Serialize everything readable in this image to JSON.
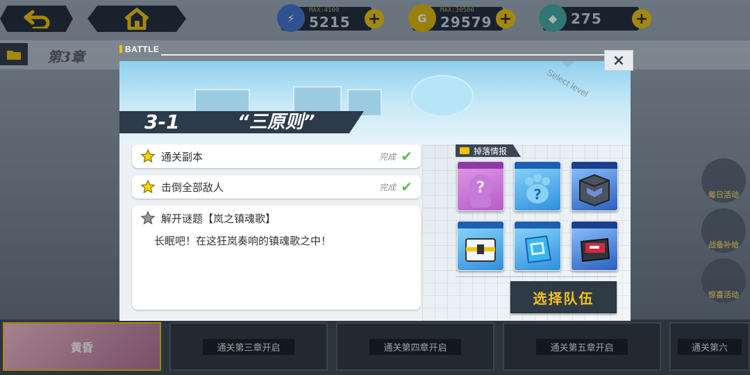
{
  "topbar": {
    "resources": [
      {
        "name": "stamina",
        "max_label": "MAX:4100",
        "value": "5215",
        "color": "#3d6fc9"
      },
      {
        "name": "coins",
        "max_label": "MAX:30500",
        "value": "29579",
        "color": "#e2b400"
      },
      {
        "name": "crystals",
        "value": "275",
        "color": "#41a6a0"
      }
    ]
  },
  "chapter": {
    "title": "第3章"
  },
  "side_buttons": [
    {
      "label": "每日活动"
    },
    {
      "label": "战备补给"
    },
    {
      "label": "惊喜活动"
    }
  ],
  "chapters": [
    {
      "text": "黄昏",
      "state": "active"
    },
    {
      "text": "通关第三章开启"
    },
    {
      "text": "通关第四章开启"
    },
    {
      "text": "通关第五章开启"
    },
    {
      "text": "通关第六"
    }
  ],
  "modal": {
    "battle_label": "BATTLE",
    "select_level": "Select level",
    "stage_number": "3-1",
    "stage_name": "“三原则”",
    "close_icon": "×",
    "objectives": [
      {
        "text": "通关副本",
        "status": "完成",
        "completed": true
      },
      {
        "text": "击倒全部敌人",
        "status": "完成",
        "completed": true
      }
    ],
    "story_objective": {
      "text": "解开谜题【岚之镇魂歌】",
      "body": "长眠吧！在这狂岚奏响的镇魂歌之中！",
      "completed": false
    },
    "drops": {
      "title": "掉落情报",
      "items": [
        {
          "name": "unknown-character",
          "glyph": "?",
          "color": "#c471d8"
        },
        {
          "name": "unknown-paw-item",
          "glyph": "?",
          "color": "#3aa6e8"
        },
        {
          "name": "equipment-chest-blue",
          "glyph": "",
          "color": "#3a6fd0"
        },
        {
          "name": "supply-crate",
          "glyph": "",
          "color": "#3a9fe0"
        },
        {
          "name": "chip-card",
          "glyph": "",
          "color": "#3aa6e8"
        },
        {
          "name": "red-cartridge",
          "glyph": "",
          "color": "#3a6fd0"
        }
      ]
    },
    "team_button": "选择队伍"
  }
}
